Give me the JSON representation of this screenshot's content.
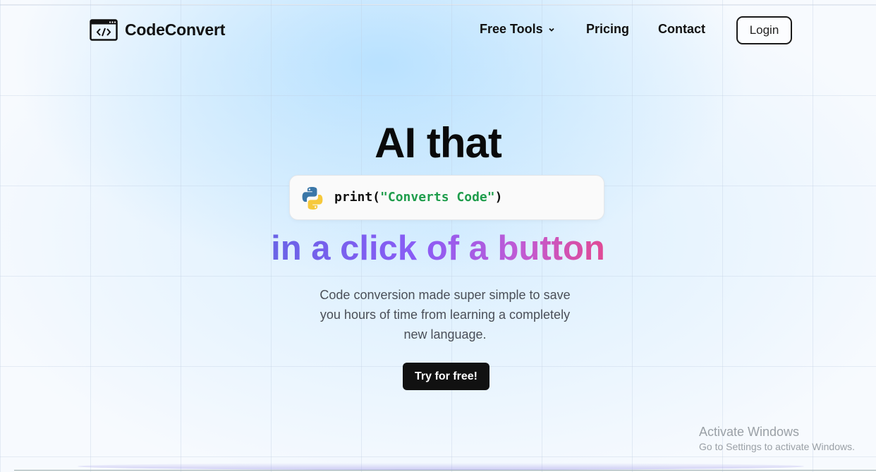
{
  "brand": {
    "name": "CodeConvert",
    "icon": "code-window-icon"
  },
  "nav": {
    "items": [
      {
        "label": "Free Tools",
        "icon": "chevron-down-icon"
      },
      {
        "label": "Pricing"
      },
      {
        "label": "Contact"
      }
    ],
    "login_label": "Login"
  },
  "hero": {
    "title": "AI that",
    "code": {
      "icon": "python-icon",
      "func": "print(",
      "string": "\"Converts Code\"",
      "close": ")"
    },
    "subtitle": "in a click of a button",
    "description_lines": [
      "Code conversion made super simple to save",
      "you hours of time from learning a completely",
      "new language."
    ],
    "cta_label": "Try for free!"
  },
  "watermark": {
    "title": "Activate Windows",
    "subtitle": "Go to Settings to activate Windows."
  },
  "colors": {
    "accent_gradient": [
      "#6a63e6",
      "#8b5cf6",
      "#c15bd3",
      "#e04a95"
    ],
    "code_string": "#1f9d4c",
    "cta_bg": "#111111"
  }
}
